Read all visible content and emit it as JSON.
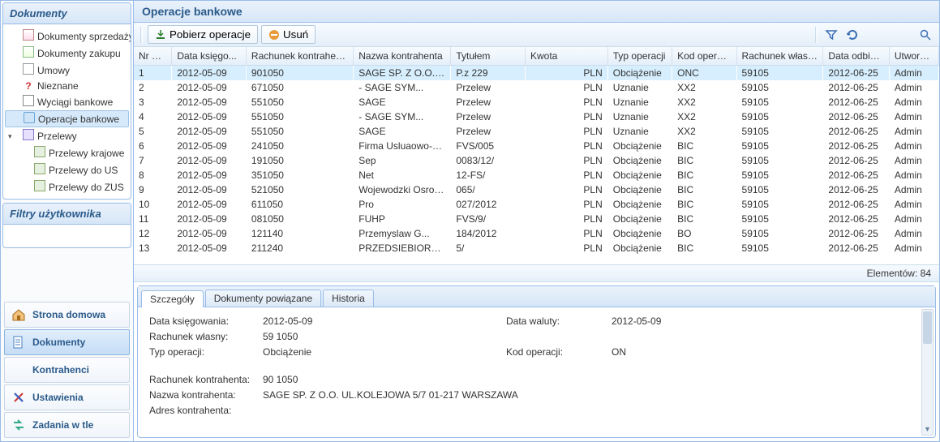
{
  "sidebar": {
    "header": "Dokumenty",
    "tree": [
      {
        "label": "Dokumenty sprzedaży",
        "icon": "doc-sale"
      },
      {
        "label": "Dokumenty zakupu",
        "icon": "doc-buy"
      },
      {
        "label": "Umowy",
        "icon": "doc-um"
      },
      {
        "label": "Nieznane",
        "icon": "unknown"
      },
      {
        "label": "Wyciągi bankowe",
        "icon": "bank"
      },
      {
        "label": "Operacje bankowe",
        "icon": "ops",
        "selected": true
      },
      {
        "label": "Przelewy",
        "icon": "transfer",
        "expanded": true,
        "children": [
          {
            "label": "Przelewy krajowe",
            "icon": "sub"
          },
          {
            "label": "Przelewy do US",
            "icon": "sub"
          },
          {
            "label": "Przelewy do ZUS",
            "icon": "sub"
          }
        ]
      }
    ],
    "filters_header": "Filtry użytkownika"
  },
  "nav": [
    {
      "id": "home",
      "label": "Strona domowa",
      "icon": "home"
    },
    {
      "id": "docs",
      "label": "Dokumenty",
      "icon": "docs",
      "active": true
    },
    {
      "id": "contractors",
      "label": "Kontrahenci",
      "icon": "contractor"
    },
    {
      "id": "settings",
      "label": "Ustawienia",
      "icon": "settings"
    },
    {
      "id": "bg",
      "label": "Zadania w tle",
      "icon": "bg"
    }
  ],
  "main": {
    "title": "Operacje bankowe",
    "toolbar": {
      "fetch": "Pobierz operacje",
      "delete": "Usuń"
    },
    "columns": [
      "Nr por...",
      "Data księgo...",
      "Rachunek kontrahenta",
      "Nazwa kontrahenta",
      "Tytułem",
      "Kwota",
      "Typ operacji",
      "Kod operacji",
      "Rachunek własny",
      "Data odbioru",
      "Utworzo..."
    ],
    "rows": [
      {
        "nr": "1",
        "dk": "2012-05-09",
        "rk": "901050",
        "nk": "SAGE SP. Z O.O. ...",
        "ty": "P.z 229",
        "kw": "PLN",
        "to": "Obciążenie",
        "ko": "ONC",
        "rw": "59105",
        "do": "2012-06-25",
        "uw": "Admin",
        "sel": true
      },
      {
        "nr": "2",
        "dk": "2012-05-09",
        "rk": "671050",
        "nk": "- SAGE SYM...",
        "ty": "Przelew",
        "kw": "PLN",
        "to": "Uznanie",
        "ko": "XX2",
        "rw": "59105",
        "do": "2012-06-25",
        "uw": "Admin"
      },
      {
        "nr": "3",
        "dk": "2012-05-09",
        "rk": "551050",
        "nk": "SAGE",
        "ty": "Przelew",
        "kw": "PLN",
        "to": "Uznanie",
        "ko": "XX2",
        "rw": "59105",
        "do": "2012-06-25",
        "uw": "Admin"
      },
      {
        "nr": "4",
        "dk": "2012-05-09",
        "rk": "551050",
        "nk": "- SAGE SYM...",
        "ty": "Przelew",
        "kw": "PLN",
        "to": "Uznanie",
        "ko": "XX2",
        "rw": "59105",
        "do": "2012-06-25",
        "uw": "Admin"
      },
      {
        "nr": "5",
        "dk": "2012-05-09",
        "rk": "551050",
        "nk": "SAGE",
        "ty": "Przelew",
        "kw": "PLN",
        "to": "Uznanie",
        "ko": "XX2",
        "rw": "59105",
        "do": "2012-06-25",
        "uw": "Admin"
      },
      {
        "nr": "6",
        "dk": "2012-05-09",
        "rk": "241050",
        "nk": "Firma Usluaowo-Ha...",
        "ty": "FVS/005",
        "kw": "PLN",
        "to": "Obciążenie",
        "ko": "BIC",
        "rw": "59105",
        "do": "2012-06-25",
        "uw": "Admin"
      },
      {
        "nr": "7",
        "dk": "2012-05-09",
        "rk": "191050",
        "nk": "Sep",
        "ty": "0083/12/",
        "kw": "PLN",
        "to": "Obciążenie",
        "ko": "BIC",
        "rw": "59105",
        "do": "2012-06-25",
        "uw": "Admin"
      },
      {
        "nr": "8",
        "dk": "2012-05-09",
        "rk": "351050",
        "nk": "Net",
        "ty": "12-FS/",
        "kw": "PLN",
        "to": "Obciążenie",
        "ko": "BIC",
        "rw": "59105",
        "do": "2012-06-25",
        "uw": "Admin"
      },
      {
        "nr": "9",
        "dk": "2012-05-09",
        "rk": "521050",
        "nk": "Wojewodzki Osrod...",
        "ty": "065/",
        "kw": "PLN",
        "to": "Obciążenie",
        "ko": "BIC",
        "rw": "59105",
        "do": "2012-06-25",
        "uw": "Admin"
      },
      {
        "nr": "10",
        "dk": "2012-05-09",
        "rk": "611050",
        "nk": "Pro",
        "ty": "027/2012",
        "kw": "PLN",
        "to": "Obciążenie",
        "ko": "BIC",
        "rw": "59105",
        "do": "2012-06-25",
        "uw": "Admin"
      },
      {
        "nr": "11",
        "dk": "2012-05-09",
        "rk": "081050",
        "nk": "FUHP",
        "ty": "FVS/9/",
        "kw": "PLN",
        "to": "Obciążenie",
        "ko": "BIC",
        "rw": "59105",
        "do": "2012-06-25",
        "uw": "Admin"
      },
      {
        "nr": "12",
        "dk": "2012-05-09",
        "rk": "121140",
        "nk": "Przemyslaw G...",
        "ty": "184/2012",
        "kw": "PLN",
        "to": "Obciążenie",
        "ko": "BO",
        "rw": "59105",
        "do": "2012-06-25",
        "uw": "Admin"
      },
      {
        "nr": "13",
        "dk": "2012-05-09",
        "rk": "211240",
        "nk": "PRZEDSIEBIORS...",
        "ty": "5/",
        "kw": "PLN",
        "to": "Obciążenie",
        "ko": "BIC",
        "rw": "59105",
        "do": "2012-06-25",
        "uw": "Admin"
      }
    ],
    "status": "Elementów: 84"
  },
  "details": {
    "tabs": [
      "Szczegóły",
      "Dokumenty powiązane",
      "Historia"
    ],
    "active_tab": 0,
    "fields": {
      "data_ksiegowania_label": "Data księgowania:",
      "data_ksiegowania": "2012-05-09",
      "data_waluty_label": "Data waluty:",
      "data_waluty": "2012-05-09",
      "rachunek_wlasny_label": "Rachunek własny:",
      "rachunek_wlasny": "59 1050",
      "typ_operacji_label": "Typ operacji:",
      "typ_operacji": "Obciążenie",
      "kod_operacji_label": "Kod operacji:",
      "kod_operacji": "ON",
      "rachunek_kontrahenta_label": "Rachunek kontrahenta:",
      "rachunek_kontrahenta": "90 1050",
      "nazwa_kontrahenta_label": "Nazwa kontrahenta:",
      "nazwa_kontrahenta": "SAGE SP. Z O.O. UL.KOLEJOWA 5/7 01-217 WARSZAWA",
      "adres_kontrahenta_label": "Adres kontrahenta:",
      "adres_kontrahenta": ""
    }
  }
}
